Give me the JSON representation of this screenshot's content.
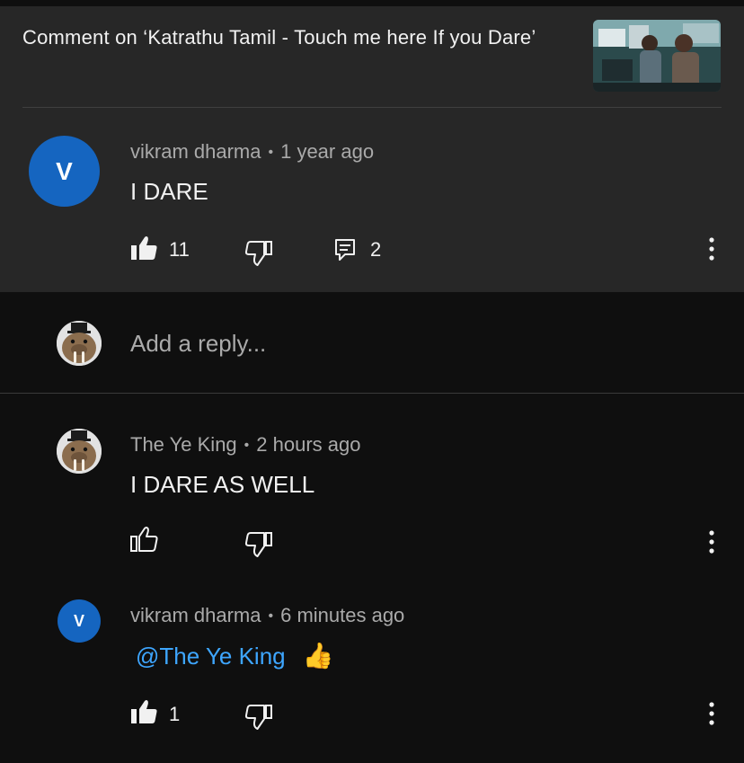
{
  "header": {
    "title": "Comment on ‘Katrathu Tamil - Touch me here If you Dare’"
  },
  "main_comment": {
    "avatar_letter": "V",
    "author": "vikram dharma",
    "separator": "•",
    "time": "1 year ago",
    "text": "I DARE",
    "like_count": "11",
    "reply_count": "2"
  },
  "reply_box": {
    "placeholder": "Add a reply..."
  },
  "replies": [
    {
      "author": "The Ye King",
      "separator": "•",
      "time": "2 hours ago",
      "text": "I DARE AS WELL"
    },
    {
      "avatar_letter": "V",
      "author": "vikram dharma",
      "separator": "•",
      "time": "6 minutes ago",
      "mention": "@The Ye King",
      "emoji": "👍",
      "like_count": "1"
    }
  ],
  "icons": {
    "like_filled": "thumbs-up-filled-icon",
    "like_outline": "thumbs-up-outline-icon",
    "dislike": "thumbs-down-outline-icon",
    "reply": "comment-icon",
    "more": "more-vertical-icon"
  },
  "colors": {
    "header_bg": "#272727",
    "page_bg": "#0f0f0f",
    "avatar_blue": "#1565c0",
    "mention_blue": "#3ea6ff",
    "meta_gray": "#aaaaaa"
  }
}
